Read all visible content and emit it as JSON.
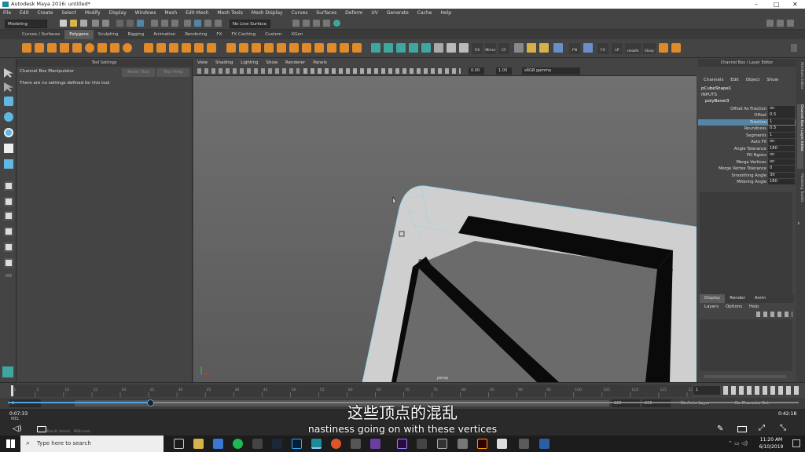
{
  "window": {
    "title": "Autodesk Maya 2016: untitled*",
    "controls": [
      "–",
      "□",
      "✕"
    ]
  },
  "menubar": [
    "File",
    "Edit",
    "Create",
    "Select",
    "Modify",
    "Display",
    "Windows",
    "Mesh",
    "Edit Mesh",
    "Mesh Tools",
    "Mesh Display",
    "Curves",
    "Surfaces",
    "Deform",
    "UV",
    "Generate",
    "Cache",
    "Help"
  ],
  "statusline": {
    "mode": "Modeling",
    "live_surface": "No Live Surface"
  },
  "shelf_tabs": [
    "Curves / Surfaces",
    "Polygons",
    "Sculpting",
    "Rigging",
    "Animation",
    "Rendering",
    "FX",
    "FX Caching",
    "Custom",
    "XGen"
  ],
  "shelf_active": "Polygons",
  "shelf_labels": {
    "fill": "Fill",
    "mirror": "Mirror",
    "fx": "FX",
    "cf": "CF",
    "fn": "FN",
    "fx2": "FX",
    "smooth": "smooth",
    "lp": "LP",
    "sharp": "Sharp"
  },
  "tool_settings": {
    "header": "Tool Settings",
    "tool_name": "Channel Box Manipulator",
    "reset_button": "Reset Tool",
    "help_button": "Tool Help",
    "message": "There are no settings defined for this tool"
  },
  "viewport": {
    "menu": [
      "View",
      "Shading",
      "Lighting",
      "Show",
      "Renderer",
      "Panels"
    ],
    "exposure": "0.00",
    "gamma": "1.00",
    "color_space": "sRGB gamma",
    "camera_label": "persp"
  },
  "channel_box": {
    "header": "Channel Box / Layer Editor",
    "menu": [
      "Channels",
      "Edit",
      "Object",
      "Show"
    ],
    "object": "pCubeShape1",
    "inputs_label": "INPUTS",
    "node": "polyBevel3",
    "attributes": [
      {
        "name": "Offset As Fraction",
        "value": "on"
      },
      {
        "name": "Offset",
        "value": "0.5"
      },
      {
        "name": "Fraction",
        "value": "1"
      },
      {
        "name": "Roundness",
        "value": "0.5"
      },
      {
        "name": "Segments",
        "value": "1"
      },
      {
        "name": "Auto Fit",
        "value": "on"
      },
      {
        "name": "Angle Tolerance",
        "value": "180"
      },
      {
        "name": "Fill Ngons",
        "value": "on"
      },
      {
        "name": "Merge Vertices",
        "value": "on"
      },
      {
        "name": "Merge Vertex Tolerance",
        "value": "0"
      },
      {
        "name": "Smoothing Angle",
        "value": "30"
      },
      {
        "name": "Mitering Angle",
        "value": "180"
      }
    ],
    "selected_attribute": "Fraction",
    "layer_tabs": [
      "Display",
      "Render",
      "Anim"
    ],
    "layer_tabs_active": "Display",
    "layer_menu": [
      "Layers",
      "Options",
      "Help"
    ],
    "side_tabs": [
      "Attribute Editor",
      "Channel Box / Layer Editor",
      "Modeling Toolkit"
    ]
  },
  "timeline": {
    "ticks": [
      "1",
      "5",
      "10",
      "15",
      "20",
      "25",
      "30",
      "35",
      "40",
      "45",
      "50",
      "55",
      "60",
      "65",
      "70",
      "75",
      "80",
      "85",
      "90",
      "95",
      "100",
      "105",
      "110",
      "115",
      "120"
    ],
    "current_frame": "1",
    "range_start": "1",
    "range_end": "120",
    "anim_end": "200",
    "anim_layer": "No Anim Layer",
    "char_set": "No Character Set"
  },
  "video": {
    "elapsed": "0:07:33",
    "duration": "0:42:18",
    "sub_left": "MEL",
    "sub_left2": "Result: /Users/... MSB.mesh",
    "progress": 0.18
  },
  "subtitles": {
    "cn": "这些顶点的混乱",
    "en": "nastiness going on with these vertices"
  },
  "taskbar": {
    "search_placeholder": "Type here to search",
    "time": "11:20 AM",
    "date": "6/10/2019"
  },
  "colors": {
    "orange": "#e08a2a",
    "teal": "#3fa6a0",
    "highlight": "#5285a6",
    "wire": "#8fd5ef"
  }
}
